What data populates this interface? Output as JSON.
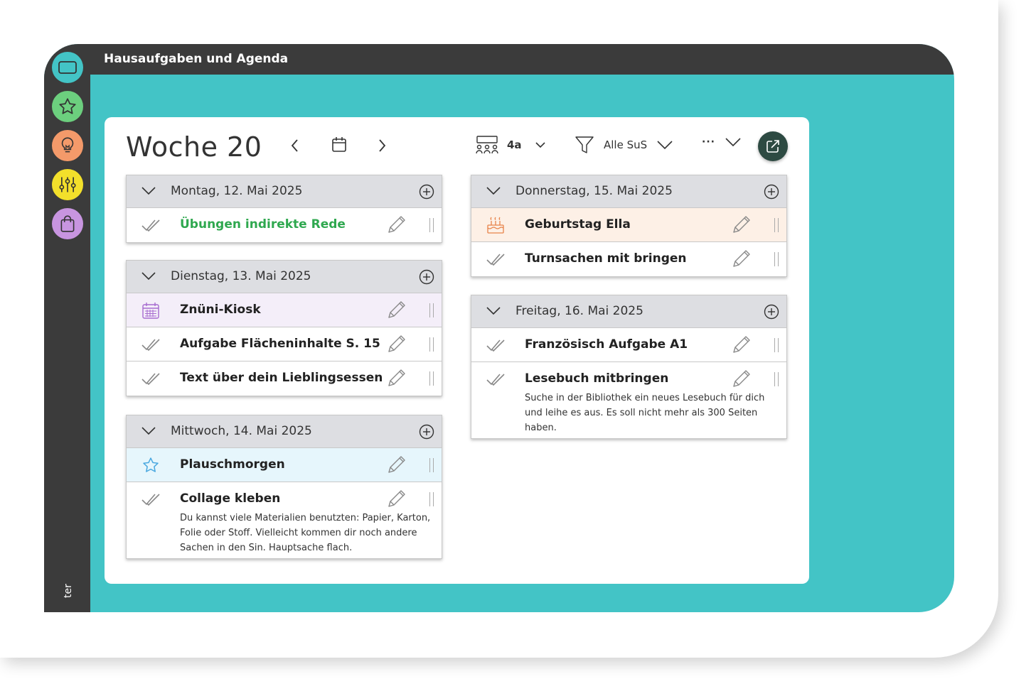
{
  "header": {
    "title": "Hausaufgaben und Agenda"
  },
  "sidebar": {
    "items": [
      {
        "name": "screen",
        "color": "#43c4c6"
      },
      {
        "name": "star",
        "color": "#6ccf7e"
      },
      {
        "name": "bulb",
        "color": "#f49a6a"
      },
      {
        "name": "sliders",
        "color": "#f3e02b"
      },
      {
        "name": "bag",
        "color": "#c895e0"
      }
    ],
    "footer_label": "ter"
  },
  "toolbar": {
    "week_title": "Woche 20",
    "class_label": "4a",
    "filter_label": "Alle SuS",
    "more_label": "···"
  },
  "days": [
    {
      "date": "Montag, 12. Mai 2025",
      "entries": [
        {
          "title": "Übungen indirekte Rede",
          "icon": "check"
        }
      ]
    },
    {
      "date": "Dienstag, 13. Mai 2025",
      "entries": [
        {
          "title": "Znüni-Kiosk",
          "icon": "calendar"
        },
        {
          "title": "Aufgabe Flächeninhalte S. 15",
          "icon": "check"
        },
        {
          "title": "Text über dein Lieblingsessen",
          "icon": "check"
        }
      ]
    },
    {
      "date": "Mittwoch, 14. Mai 2025",
      "entries": [
        {
          "title": "Plauschmorgen",
          "icon": "star"
        },
        {
          "title": "Collage kleben",
          "icon": "check",
          "description": "Du kannst viele Materialien benutzten: Papier, Karton, Folie oder Stoff. Vielleicht kommen dir noch andere Sachen in den Sin. Hauptsache flach."
        }
      ]
    },
    {
      "date": "Donnerstag, 15. Mai 2025",
      "entries": [
        {
          "title": "Geburtstag Ella",
          "icon": "cake"
        },
        {
          "title": "Turnsachen mit bringen",
          "icon": "check"
        }
      ]
    },
    {
      "date": "Freitag, 16. Mai 2025",
      "entries": [
        {
          "title": "Französisch Aufgabe A1",
          "icon": "check"
        },
        {
          "title": "Lesebuch mitbringen",
          "icon": "check",
          "description": "Suche in der Bibliothek ein neues Lesebuch für dich und leihe es aus. Es soll nicht mehr als 300 Seiten haben."
        }
      ]
    }
  ],
  "colors": {
    "accent": "#43c4c6",
    "dark": "#3b3b3b",
    "done_green": "#2fa84f",
    "event_purple": "#f4eef9",
    "event_blue": "#e6f6fc",
    "event_orange": "#fdf0e6"
  }
}
